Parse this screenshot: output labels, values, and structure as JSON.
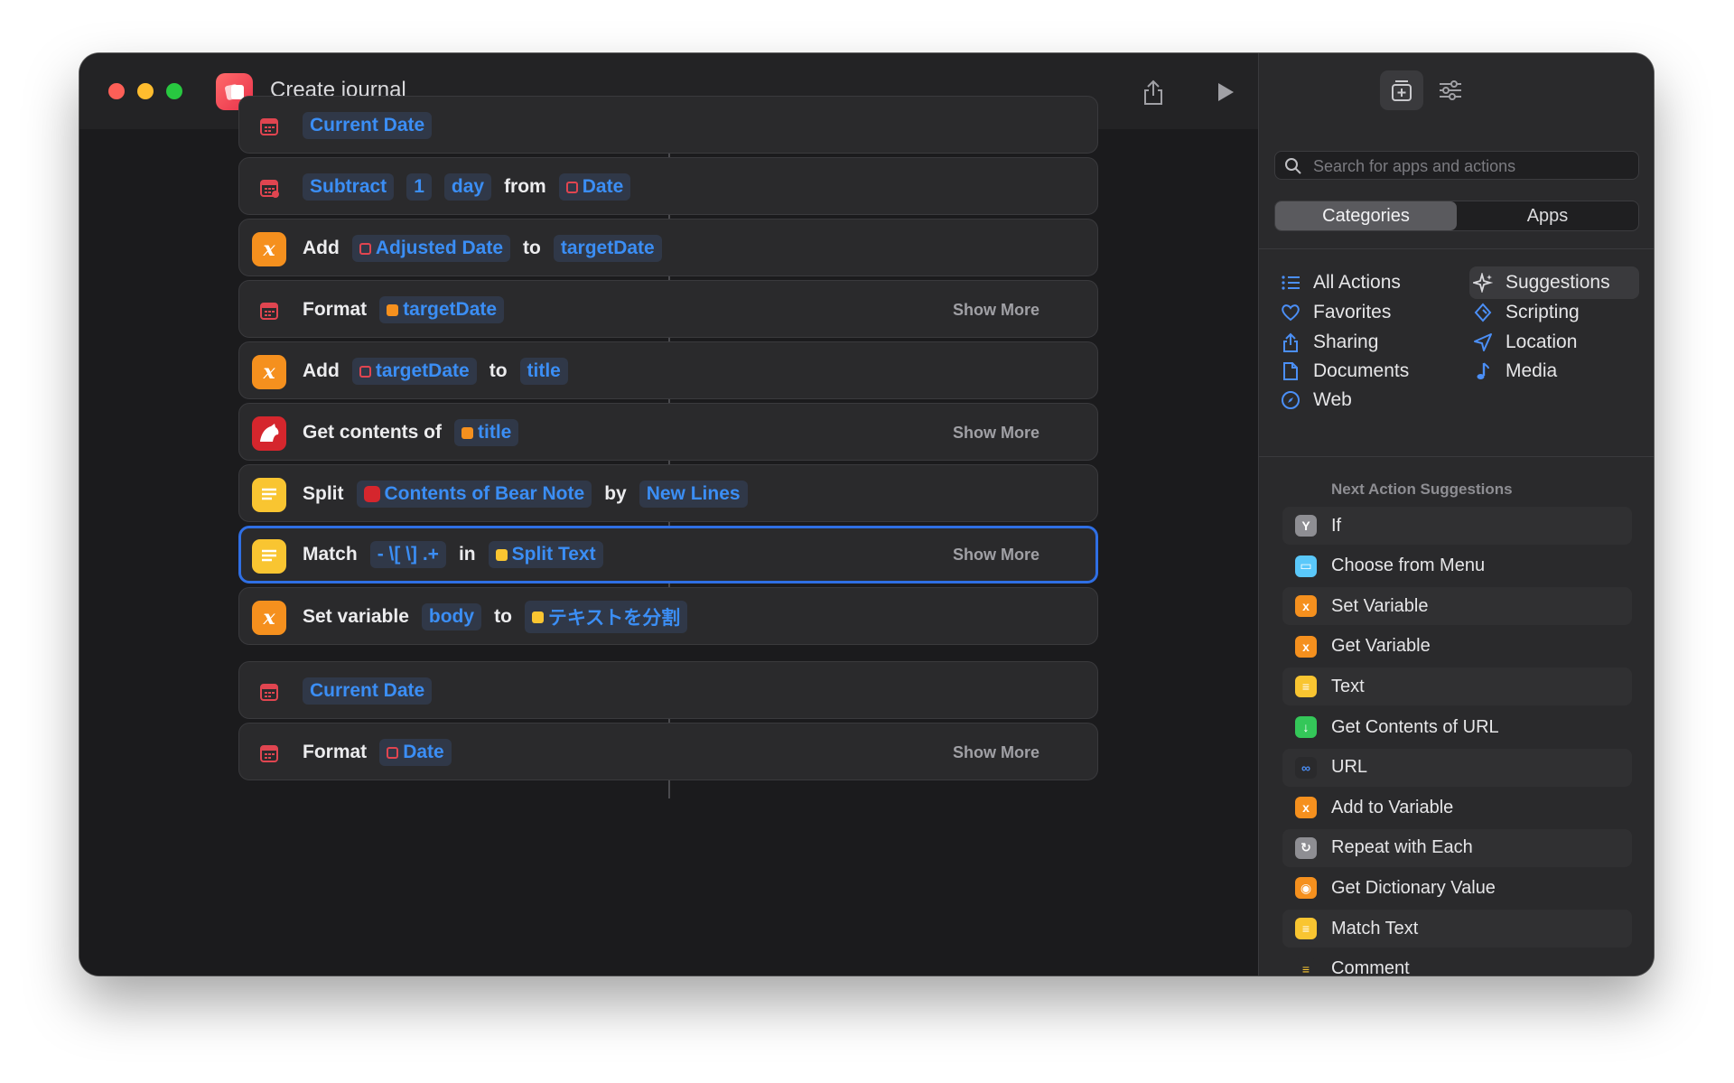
{
  "window": {
    "title": "Create journal"
  },
  "actions": [
    {
      "type": "calendar",
      "parts": [
        {
          "k": "tok",
          "t": "Current Date"
        }
      ]
    },
    {
      "type": "calendar-sub",
      "parts": [
        {
          "k": "tok",
          "t": "Subtract"
        },
        {
          "k": "tok",
          "t": "1"
        },
        {
          "k": "tok",
          "t": "day"
        },
        {
          "k": "kw",
          "t": "from"
        },
        {
          "k": "tok",
          "t": "Date",
          "m": "red"
        }
      ]
    },
    {
      "type": "var",
      "parts": [
        {
          "k": "kw",
          "t": "Add"
        },
        {
          "k": "tok",
          "t": "Adjusted Date",
          "m": "red"
        },
        {
          "k": "kw",
          "t": "to"
        },
        {
          "k": "tok",
          "t": "targetDate"
        }
      ]
    },
    {
      "type": "calendar",
      "parts": [
        {
          "k": "kw",
          "t": "Format"
        },
        {
          "k": "tok",
          "t": "targetDate",
          "m": "orange"
        }
      ],
      "show_more": "Show More"
    },
    {
      "type": "var",
      "parts": [
        {
          "k": "kw",
          "t": "Add"
        },
        {
          "k": "tok",
          "t": "targetDate",
          "m": "red"
        },
        {
          "k": "kw",
          "t": "to"
        },
        {
          "k": "tok",
          "t": "title"
        }
      ]
    },
    {
      "type": "bear",
      "parts": [
        {
          "k": "kw",
          "t": "Get contents of"
        },
        {
          "k": "tok",
          "t": "title",
          "m": "orange"
        }
      ],
      "show_more": "Show More"
    },
    {
      "type": "text",
      "parts": [
        {
          "k": "kw",
          "t": "Split"
        },
        {
          "k": "tok",
          "t": "Contents of Bear Note",
          "m": "bear"
        },
        {
          "k": "kw",
          "t": "by"
        },
        {
          "k": "tok",
          "t": "New Lines"
        }
      ]
    },
    {
      "type": "text",
      "selected": true,
      "parts": [
        {
          "k": "kw",
          "t": "Match"
        },
        {
          "k": "tok",
          "t": "- \\[ \\] .+"
        },
        {
          "k": "kw",
          "t": "in"
        },
        {
          "k": "tok",
          "t": "Split Text",
          "m": "yellow"
        }
      ],
      "show_more": "Show More"
    },
    {
      "type": "var",
      "parts": [
        {
          "k": "kw",
          "t": "Set variable"
        },
        {
          "k": "tok",
          "t": "body"
        },
        {
          "k": "kw",
          "t": "to"
        },
        {
          "k": "tok",
          "t": "テキストを分割",
          "m": "yellow"
        }
      ]
    },
    {
      "type": "calendar",
      "parts": [
        {
          "k": "tok",
          "t": "Current Date"
        }
      ]
    },
    {
      "type": "calendar",
      "parts": [
        {
          "k": "kw",
          "t": "Format"
        },
        {
          "k": "tok",
          "t": "Date",
          "m": "red"
        }
      ],
      "show_more": "Show More"
    }
  ],
  "sidebar": {
    "search_placeholder": "Search for apps and actions",
    "segments": [
      "Categories",
      "Apps"
    ],
    "categories_left": [
      {
        "label": "All Actions",
        "icon": "list-icon"
      },
      {
        "label": "Favorites",
        "icon": "heart-icon"
      },
      {
        "label": "Sharing",
        "icon": "share-icon"
      },
      {
        "label": "Documents",
        "icon": "document-icon"
      },
      {
        "label": "Web",
        "icon": "compass-icon"
      }
    ],
    "categories_right": [
      {
        "label": "Suggestions",
        "icon": "sparkle-icon"
      },
      {
        "label": "Scripting",
        "icon": "scripting-icon"
      },
      {
        "label": "Location",
        "icon": "location-icon"
      },
      {
        "label": "Media",
        "icon": "music-note-icon"
      }
    ],
    "next_title": "Next Action Suggestions",
    "suggestions": [
      {
        "label": "If",
        "color": "#8e8e93"
      },
      {
        "label": "Choose from Menu",
        "color": "#5ac8fa"
      },
      {
        "label": "Set Variable",
        "color": "#f5901e"
      },
      {
        "label": "Get Variable",
        "color": "#f5901e"
      },
      {
        "label": "Text",
        "color": "#f9c531"
      },
      {
        "label": "Get Contents of URL",
        "color": "#34c759"
      },
      {
        "label": "URL",
        "color": "#2a2a2c"
      },
      {
        "label": "Add to Variable",
        "color": "#f5901e"
      },
      {
        "label": "Repeat with Each",
        "color": "#8e8e93"
      },
      {
        "label": "Get Dictionary Value",
        "color": "#f5901e"
      },
      {
        "label": "Match Text",
        "color": "#f9c531"
      },
      {
        "label": "Comment",
        "color": "#2a2a2c"
      }
    ]
  }
}
